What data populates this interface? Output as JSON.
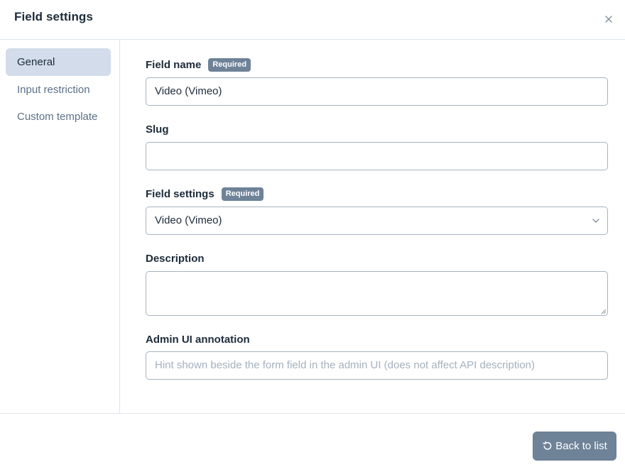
{
  "dialog": {
    "title": "Field settings",
    "close_icon": "close-icon"
  },
  "sidebar": {
    "items": [
      {
        "label": "General",
        "active": true
      },
      {
        "label": "Input restriction",
        "active": false
      },
      {
        "label": "Custom template",
        "active": false
      }
    ]
  },
  "form": {
    "field_name": {
      "label": "Field name",
      "badge": "Required",
      "value": "Video (Vimeo)"
    },
    "slug": {
      "label": "Slug",
      "value": ""
    },
    "field_settings": {
      "label": "Field settings",
      "badge": "Required",
      "selected": "Video (Vimeo)"
    },
    "description": {
      "label": "Description",
      "value": ""
    },
    "admin_annotation": {
      "label": "Admin UI annotation",
      "placeholder": "Hint shown beside the form field in the admin UI (does not affect API description)"
    }
  },
  "footer": {
    "back_label": "Back to list",
    "back_icon": "undo-icon"
  },
  "colors": {
    "active_nav_bg": "#d2dcea",
    "badge_bg": "#6e8298",
    "button_bg": "#6e8298",
    "border": "#a6b3c2"
  }
}
